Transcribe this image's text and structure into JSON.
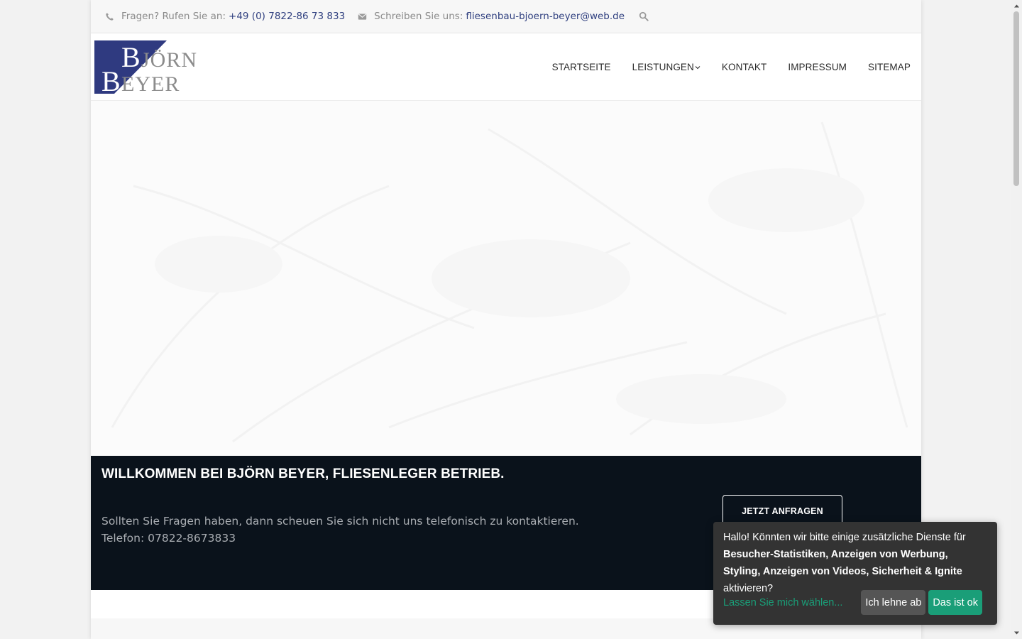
{
  "topbar": {
    "phone_label": "Fragen? Rufen Sie an:",
    "phone_number": "+49 (0) 7822-86 73 833",
    "email_label": "Schreiben Sie uns:",
    "email_address": "fliesenbau-bjoern-beyer@web.de",
    "icons": [
      "phone-icon",
      "envelope-icon",
      "search-icon"
    ]
  },
  "logo": {
    "line1": "BJÖRN",
    "line2": "BEYER",
    "colors": {
      "navy": "#2f3a80",
      "grey": "#8c8c8c"
    }
  },
  "nav": {
    "items": [
      {
        "label": "STARTSEITE"
      },
      {
        "label": "LEISTUNGEN",
        "has_dropdown": true
      },
      {
        "label": "KONTAKT"
      },
      {
        "label": "IMPRESSUM"
      },
      {
        "label": "SITEMAP"
      }
    ]
  },
  "band": {
    "title": "WILLKOMMEN BEI BJÖRN BEYER, FLIESENLEGER BETRIEB.",
    "text": "Sollten Sie Fragen haben, dann scheuen Sie sich nicht uns telefonisch zu kontaktieren. Telefon: 07822-8673833",
    "cta_label": "JETZT ANFRAGEN",
    "background": "#0a121b"
  },
  "consent": {
    "msg_intro": "Hallo! Könnten wir bitte einige zusätzliche Dienste für ",
    "msg_bold": "Besucher-Statistiken, Anzeigen von Werbung, Styling, Anzeigen von Videos, Sicherheit & Ignite",
    "msg_end": " aktivieren?",
    "choose_label": "Lassen Sie mich wählen...",
    "decline_label": "Ich lehne ab",
    "accept_label": "Das ist ok",
    "accent_color": "#1a9e78"
  },
  "colors": {
    "link": "#2f3f7f",
    "muted_text": "#8a8a8a"
  }
}
